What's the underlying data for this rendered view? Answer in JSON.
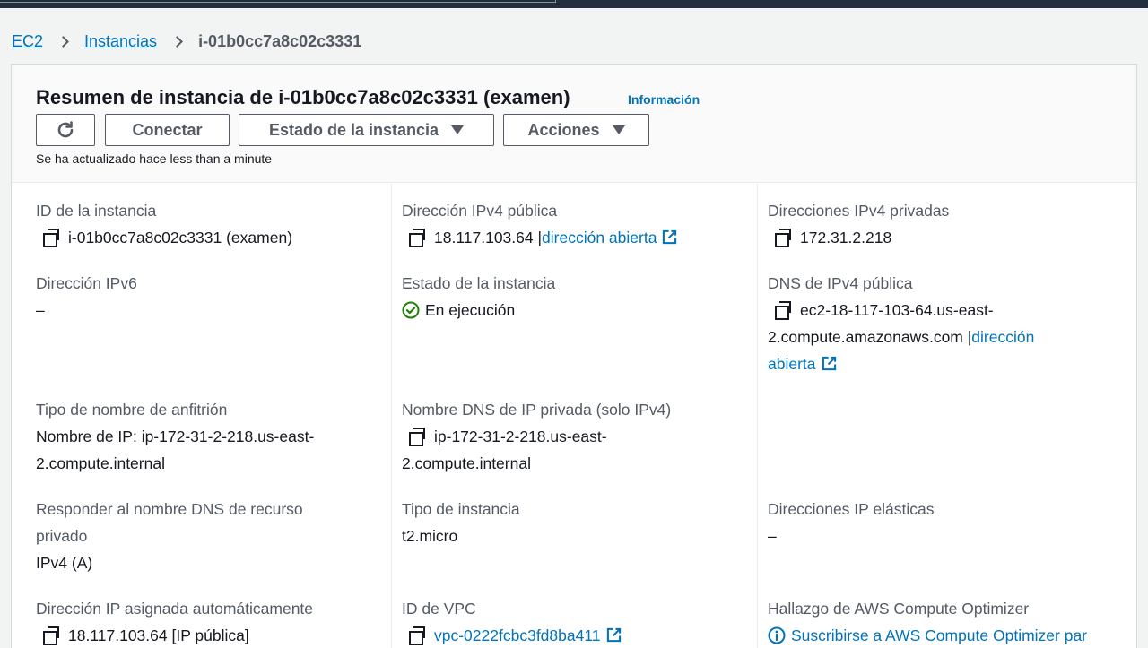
{
  "breadcrumb": {
    "root": "EC2",
    "section": "Instancias",
    "current": "i-01b0cc7a8c02c3331"
  },
  "header": {
    "title": "Resumen de instancia de i-01b0cc7a8c02c3331 (examen)",
    "info_link": "Información",
    "connect_label": "Conectar",
    "state_label": "Estado de la instancia",
    "actions_label": "Acciones",
    "updated_text": "Se ha actualizado hace less than a minute"
  },
  "fields": {
    "instance_id": {
      "label": "ID de la instancia",
      "value": "i-01b0cc7a8c02c3331 (examen)"
    },
    "public_ipv4": {
      "label": "Dirección IPv4 pública",
      "value": "18.117.103.64 |",
      "link": "dirección abierta"
    },
    "private_ipv4": {
      "label": "Direcciones IPv4 privadas",
      "value": "172.31.2.218"
    },
    "ipv6": {
      "label": "Dirección IPv6",
      "value": "–"
    },
    "instance_state": {
      "label": "Estado de la instancia",
      "value": "En ejecución"
    },
    "public_dns": {
      "label": "DNS de IPv4 pública",
      "value_line1": "ec2-18-117-103-64.us-east-",
      "value_line2": "2.compute.amazonaws.com |",
      "link_part1": "dirección",
      "link_part2": "abierta"
    },
    "hostname_type": {
      "label": "Tipo de nombre de anfitrión",
      "value_line1": "Nombre de IP: ip-172-31-2-218.us-east-",
      "value_line2": "2.compute.internal"
    },
    "private_dns": {
      "label": "Nombre DNS de IP privada (solo IPv4)",
      "value_line1": "ip-172-31-2-218.us-east-",
      "value_line2": "2.compute.internal"
    },
    "resource_dns": {
      "label_line1": "Responder al nombre DNS de recurso",
      "label_line2": "privado",
      "value": "IPv4 (A)"
    },
    "instance_type": {
      "label": "Tipo de instancia",
      "value": "t2.micro"
    },
    "elastic_ip": {
      "label": "Direcciones IP elásticas",
      "value": "–"
    },
    "auto_ip": {
      "label": "Dirección IP asignada automáticamente",
      "value": "18.117.103.64 [IP pública]"
    },
    "vpc_id": {
      "label": "ID de VPC",
      "value": "vpc-0222fcbc3fd8ba411"
    },
    "compute_optimizer": {
      "label": "Hallazgo de AWS Compute Optimizer",
      "value": "Suscribirse a AWS Compute Optimizer par"
    }
  },
  "colors": {
    "link": "#0073bb",
    "success": "#1d8102",
    "text": "#16191f",
    "label": "#545b64",
    "topbar": "#232f3e"
  },
  "icons": [
    "refresh-icon",
    "caret-down-icon",
    "copy-icon",
    "external-link-icon",
    "status-ok-icon",
    "info-icon"
  ]
}
